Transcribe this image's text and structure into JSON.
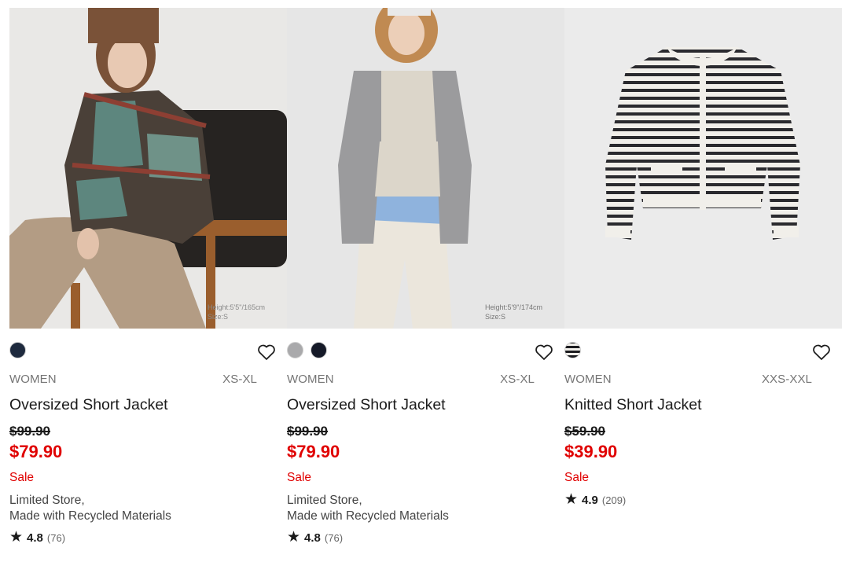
{
  "products": [
    {
      "category": "WOMEN",
      "sizes": "XS-XL",
      "name": "Oversized Short Jacket",
      "original_price": "$99.90",
      "sale_price": "$79.90",
      "flag": "Sale",
      "note_line1": "Limited Store,",
      "note_line2": "Made with Recycled Materials",
      "rating": "4.8",
      "review_count": "(76)",
      "swatch_colors": [
        "#1e2a3e"
      ],
      "photo_caption_1": "Height:5'5\"/165cm",
      "photo_caption_2": "Size:S"
    },
    {
      "category": "WOMEN",
      "sizes": "XS-XL",
      "name": "Oversized Short Jacket",
      "original_price": "$99.90",
      "sale_price": "$79.90",
      "flag": "Sale",
      "note_line1": "Limited Store,",
      "note_line2": "Made with Recycled Materials",
      "rating": "4.8",
      "review_count": "(76)",
      "swatch_colors": [
        "#a9a9ab",
        "#151a28"
      ],
      "photo_caption_1": "Height:5'9\"/174cm",
      "photo_caption_2": "Size:S"
    },
    {
      "category": "WOMEN",
      "sizes": "XXS-XXL",
      "name": "Knitted Short Jacket",
      "original_price": "$59.90",
      "sale_price": "$39.90",
      "flag": "Sale",
      "rating": "4.9",
      "review_count": "(209)",
      "swatch_colors": [
        "striped-black-white"
      ]
    }
  ],
  "icons": {
    "favorite": "heart-outline-icon",
    "rating": "star-icon"
  },
  "colors": {
    "sale_red": "#e00000",
    "text": "#1b1b1b",
    "muted": "#757575"
  }
}
